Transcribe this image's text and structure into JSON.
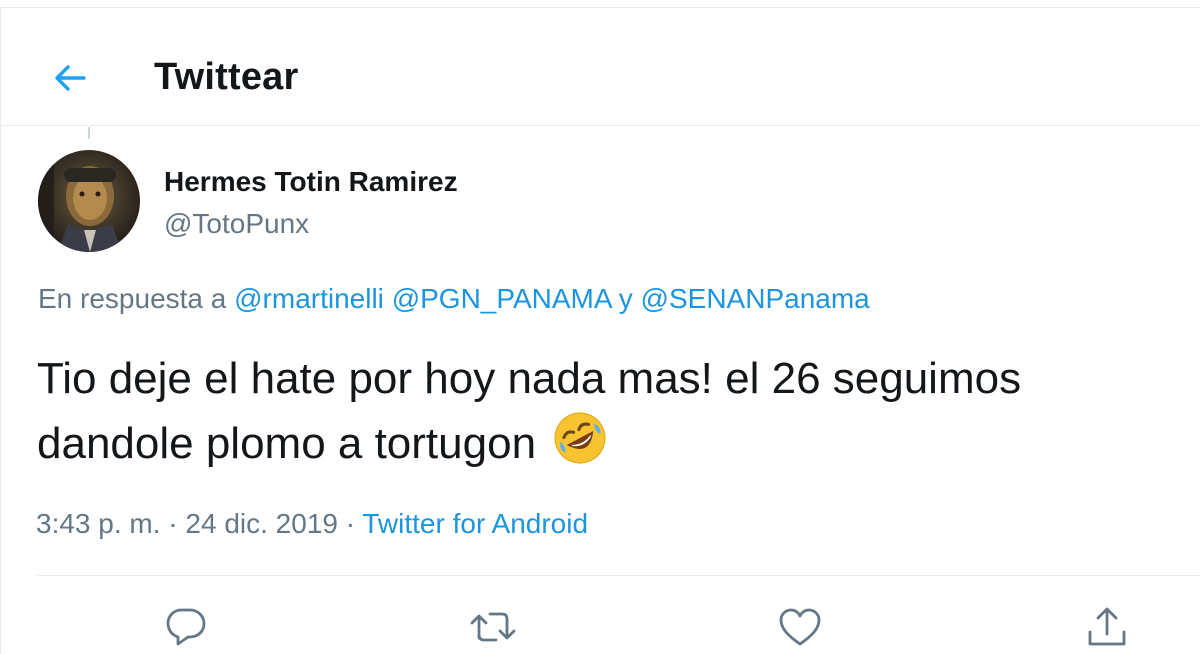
{
  "header": {
    "title": "Twittear",
    "back_icon": "arrow-left-icon",
    "accent": "#1da1f2"
  },
  "tweet": {
    "author": {
      "name": "Hermes Totin Ramirez",
      "handle": "@TotoPunx"
    },
    "reply_to": {
      "prefix": "En respuesta a",
      "mentions": [
        "@rmartinelli",
        "@PGN_PANAMA",
        "@SENANPanama"
      ],
      "separator": "y"
    },
    "text": "Tio deje el hate por hoy nada mas! el 26 seguimos dandole plomo a tortugon",
    "emoji": "rolling-on-floor-laughing",
    "meta": {
      "time": "3:43 p. m.",
      "date": "24 dic. 2019",
      "source": "Twitter for Android",
      "dot": "·"
    }
  },
  "actions": [
    "reply-icon",
    "retweet-icon",
    "like-icon",
    "share-icon"
  ],
  "colors": {
    "link": "#1b95e0",
    "secondary_text": "#657786",
    "border": "#e6ecf0",
    "text": "#14171a"
  }
}
